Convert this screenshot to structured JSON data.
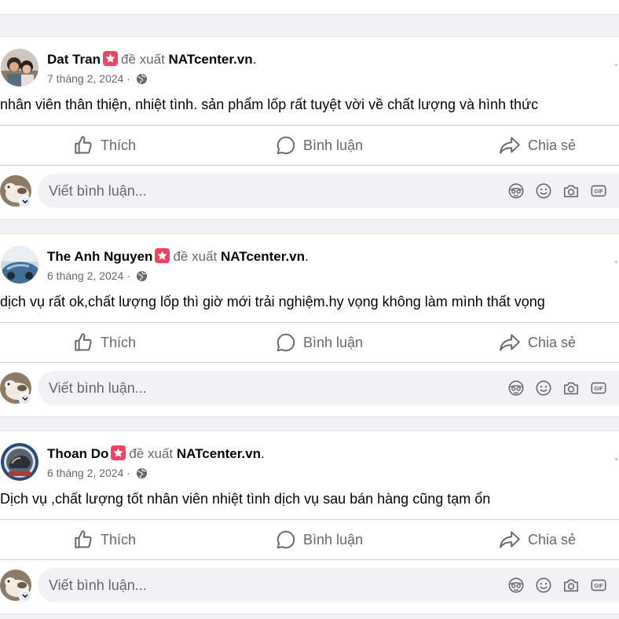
{
  "posts": [
    {
      "author": "Dat Tran",
      "verb": "đề xuất",
      "page": "NATcenter.vn",
      "period": ".",
      "date": "7 tháng 2, 2024 ·",
      "text": "nhân viên thân thiện, nhiệt tình. sản phẩm lốp rất tuyệt vời về chất lượng và hình thức"
    },
    {
      "author": "The Anh Nguyen",
      "verb": "đề xuất",
      "page": "NATcenter.vn",
      "period": ".",
      "date": "6 tháng 2, 2024 ·",
      "text": "dịch vụ rất ok,chất lượng lốp thì giờ mới trải nghiệm.hy vọng không làm mình thất vọng"
    },
    {
      "author": "Thoan Do",
      "verb": "đề xuất",
      "page": "NATcenter.vn",
      "period": ".",
      "date": "6 tháng 2, 2024 ·",
      "text": "Dịch vụ ,chất lượng tốt nhân viên nhiệt tình dịch vụ sau bán hàng cũng tạm ổn"
    }
  ],
  "actions": {
    "like": "Thích",
    "comment": "Bình luận",
    "share": "Chia sẻ"
  },
  "comment_placeholder": "Viết bình luận...",
  "icons": {
    "badge": "recommend-star-icon",
    "privacy": "globe-icon",
    "like": "thumbs-up-icon",
    "comment": "speech-bubble-icon",
    "share": "share-arrow-icon",
    "composer": [
      "avatar-sticker-icon",
      "emoji-icon",
      "camera-icon",
      "gif-icon"
    ]
  },
  "colors": {
    "badge": "#f3425f",
    "secondary_text": "#65676b",
    "primary_text": "#050505",
    "input_bg": "#f0f2f5"
  }
}
